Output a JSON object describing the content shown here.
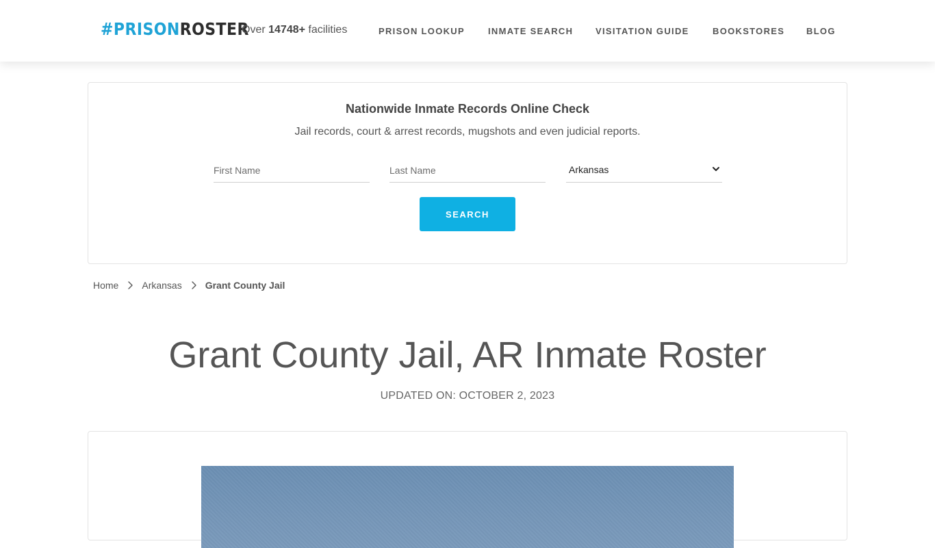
{
  "header": {
    "logo": {
      "hash": "#",
      "prison": "PRISON",
      "roster": "ROSTER"
    },
    "facilities": {
      "prefix": "Over",
      "count": "14748+",
      "suffix": "facilities"
    },
    "nav": [
      "PRISON LOOKUP",
      "INMATE SEARCH",
      "VISITATION GUIDE",
      "BOOKSTORES",
      "BLOG"
    ]
  },
  "search": {
    "title": "Nationwide Inmate Records Online Check",
    "subtitle": "Jail records, court & arrest records, mugshots and even judicial reports.",
    "first_name_placeholder": "First Name",
    "last_name_placeholder": "Last Name",
    "state_selected": "Arkansas",
    "button_label": "SEARCH"
  },
  "breadcrumb": {
    "home": "Home",
    "state": "Arkansas",
    "current": "Grant County Jail"
  },
  "page": {
    "title": "Grant County Jail, AR Inmate Roster",
    "updated": "UPDATED ON: OCTOBER 2, 2023"
  },
  "colors": {
    "accent": "#0fb0e3",
    "logo_blue": "#1fa3d6",
    "text": "#555555"
  },
  "icons": {
    "select_chevron": "chevron-down-icon",
    "breadcrumb_separator": "chevron-right-icon"
  }
}
